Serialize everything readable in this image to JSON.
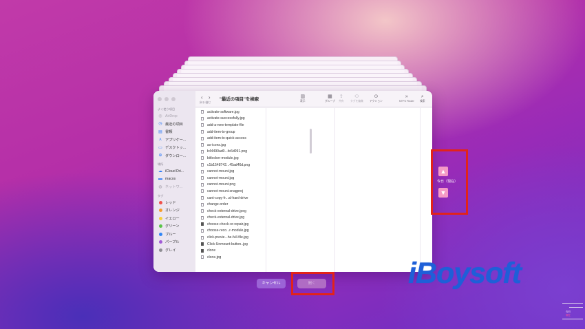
{
  "finder": {
    "title": "\"最近の項目\"を検索",
    "back_forward_label": "戻る/進む",
    "toolbar": [
      {
        "label": "表示",
        "icon": "view-options-icon",
        "glyph": "▥",
        "enabled": true
      },
      {
        "label": "グループ",
        "icon": "group-icon",
        "glyph": "▦",
        "enabled": true
      },
      {
        "label": "共有",
        "icon": "share-icon",
        "glyph": "⇪",
        "enabled": false
      },
      {
        "label": "タグを編集",
        "icon": "tag-icon",
        "glyph": "⬭",
        "enabled": false
      },
      {
        "label": "アクション",
        "icon": "action-icon",
        "glyph": "⊙",
        "enabled": true
      },
      {
        "label": "NTFS Finder",
        "icon": "ntfs-finder-icon",
        "glyph": "»",
        "enabled": true
      },
      {
        "label": "検索",
        "icon": "search-icon",
        "glyph": "⌕",
        "enabled": true
      }
    ],
    "sidebar": {
      "favorites_header": "よく使う項目",
      "favorites": [
        {
          "label": "AirDrop",
          "icon": "airdrop-icon",
          "glyph": "◎",
          "dim": true
        },
        {
          "label": "最近の項目",
          "icon": "recents-icon",
          "glyph": "◷",
          "dim": false
        },
        {
          "label": "書類",
          "icon": "documents-icon",
          "glyph": "▤",
          "dim": false
        },
        {
          "label": "アプリケー...",
          "icon": "applications-icon",
          "glyph": "⋏",
          "dim": false
        },
        {
          "label": "デスクトッ...",
          "icon": "desktop-icon",
          "glyph": "▭",
          "dim": false
        },
        {
          "label": "ダウンロー...",
          "icon": "downloads-icon",
          "glyph": "⊕",
          "dim": false
        }
      ],
      "locations_header": "場所",
      "locations": [
        {
          "label": "iCloud Dri...",
          "icon": "icloud-icon",
          "glyph": "☁",
          "dim": false
        },
        {
          "label": "macos",
          "icon": "disk-icon",
          "glyph": "▬",
          "dim": false
        },
        {
          "label": "ネットワ...",
          "icon": "network-icon",
          "glyph": "◍",
          "dim": true
        }
      ],
      "tags_header": "タグ",
      "tags": [
        {
          "label": "レッド",
          "color": "#f0504a"
        },
        {
          "label": "オレンジ",
          "color": "#f59b2b"
        },
        {
          "label": "イエロー",
          "color": "#f7cf3a"
        },
        {
          "label": "グリーン",
          "color": "#5ac448"
        },
        {
          "label": "ブルー",
          "color": "#2f86f6"
        },
        {
          "label": "パープル",
          "color": "#a15bd6"
        },
        {
          "label": "グレイ",
          "color": "#8e8e93"
        }
      ]
    },
    "files": [
      {
        "name": "activate-software.jpg",
        "dark": false
      },
      {
        "name": "activate-successfully.jpg",
        "dark": false
      },
      {
        "name": "add-a-new-template-file",
        "dark": false
      },
      {
        "name": "add-item-to-group",
        "dark": false
      },
      {
        "name": "add-item-to-quick-access",
        "dark": false
      },
      {
        "name": "as-icons.jpg",
        "dark": false
      },
      {
        "name": "b44490ad0...fe6d091.png",
        "dark": false
      },
      {
        "name": "bitlocker-module.jpg",
        "dark": false
      },
      {
        "name": "c1b1548742...45ad46d.png",
        "dark": false
      },
      {
        "name": "cannot-mount.jpg",
        "dark": false
      },
      {
        "name": "cannot-mount.jpg",
        "dark": false
      },
      {
        "name": "cannot-mount.png",
        "dark": false
      },
      {
        "name": "cannot-mount.snagproj",
        "dark": false
      },
      {
        "name": "cant-copy-fr...al-hard-drive",
        "dark": false
      },
      {
        "name": "change-order",
        "dark": false
      },
      {
        "name": "check-external-drive.jpeg",
        "dark": false
      },
      {
        "name": "check-external-drive.jpg",
        "dark": false
      },
      {
        "name": "choose-check-or-repair.jpg",
        "dark": true
      },
      {
        "name": "choose-reco...r-module.jpg",
        "dark": false
      },
      {
        "name": "click-previe...he-full-file.jpg",
        "dark": false
      },
      {
        "name": "Click-Unmount-button..jpg",
        "dark": true
      },
      {
        "name": "clone",
        "dark": true
      },
      {
        "name": "clone.jpg",
        "dark": false
      }
    ]
  },
  "buttons": {
    "cancel": "キャンセル",
    "open": "開く"
  },
  "time_machine": {
    "label": "今日（現在）",
    "up": "▲",
    "down": "▼",
    "timeline_labels": [
      "今日",
      "現在"
    ]
  },
  "watermark": "iBoysoft",
  "colors": {
    "highlight_box": "#e2231a",
    "cancel_button": "#9b63d6",
    "arrow_button": "#f59ac6"
  }
}
